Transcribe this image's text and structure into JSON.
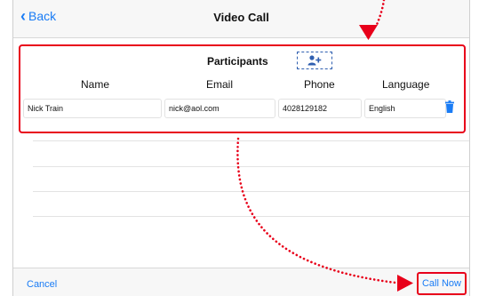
{
  "navbar": {
    "back_label": "Back",
    "title": "Video Call"
  },
  "participants": {
    "title": "Participants",
    "columns": [
      "Name",
      "Email",
      "Phone",
      "Language"
    ],
    "rows": [
      {
        "name": "Nick Train",
        "email": "nick@aol.com",
        "phone": "4028129182",
        "language": "English"
      }
    ]
  },
  "toolbar": {
    "cancel_label": "Cancel",
    "call_now_label": "Call Now"
  },
  "colors": {
    "accent": "#1a7cf5",
    "highlight": "#e8001a",
    "add_icon": "#2f5fb0"
  }
}
